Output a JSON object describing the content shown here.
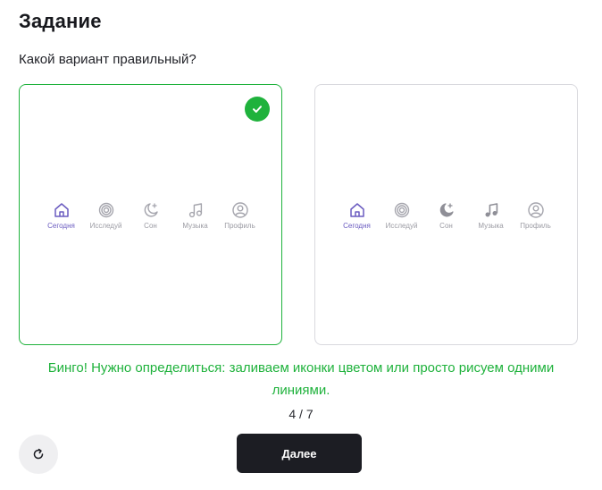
{
  "task": {
    "title": "Задание",
    "question": "Какой вариант правильный?"
  },
  "options": [
    {
      "state": "correct",
      "style": "outline",
      "tabs": [
        {
          "icon": "home-icon",
          "label": "Сегодня",
          "active": true
        },
        {
          "icon": "target-icon",
          "label": "Исследуй",
          "active": false
        },
        {
          "icon": "moon-star-icon",
          "label": "Сон",
          "active": false
        },
        {
          "icon": "music-note-icon",
          "label": "Музыка",
          "active": false
        },
        {
          "icon": "profile-icon",
          "label": "Профиль",
          "active": false
        }
      ]
    },
    {
      "state": "unselected",
      "style": "mixed-filled",
      "tabs": [
        {
          "icon": "home-icon",
          "label": "Сегодня",
          "active": true
        },
        {
          "icon": "target-icon",
          "label": "Исследуй",
          "active": false
        },
        {
          "icon": "moon-star-filled-icon",
          "label": "Сон",
          "active": false
        },
        {
          "icon": "music-note-filled-icon",
          "label": "Музыка",
          "active": false
        },
        {
          "icon": "profile-icon",
          "label": "Профиль",
          "active": false
        }
      ]
    }
  ],
  "feedback": "Бинго! Нужно определиться: заливаем иконки цветом или просто рисуем одними линиями.",
  "progress": {
    "label": "4 / 7",
    "current": 4,
    "total": 7
  },
  "actions": {
    "retry_icon": "refresh-icon",
    "next_label": "Далее"
  },
  "colors": {
    "correct": "#1fb23c",
    "active_tab": "#6a5bc0",
    "inactive_tab": "#9b9ba3",
    "button_dark": "#1c1d23"
  }
}
